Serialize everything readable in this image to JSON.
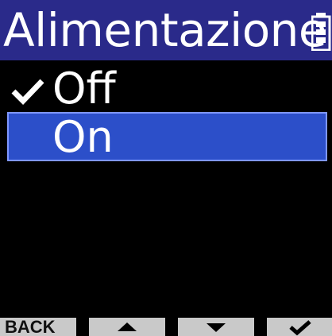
{
  "header": {
    "title": "Alimentazione F",
    "status_icon": "battery-icon"
  },
  "menu": {
    "items": [
      {
        "label": "Off",
        "checked": true,
        "selected": false
      },
      {
        "label": "On",
        "checked": false,
        "selected": true
      }
    ]
  },
  "softkeys": {
    "back_label": "BACK",
    "up_icon": "triangle-up-icon",
    "down_icon": "triangle-down-icon",
    "confirm_icon": "check-icon"
  },
  "colors": {
    "header_bg": "#2a2a8a",
    "selection_bg": "#2c4fc9",
    "selection_border": "#7f97ff",
    "background": "#000000",
    "text": "#ffffff",
    "softkey_bg": "#c9c9c9"
  }
}
